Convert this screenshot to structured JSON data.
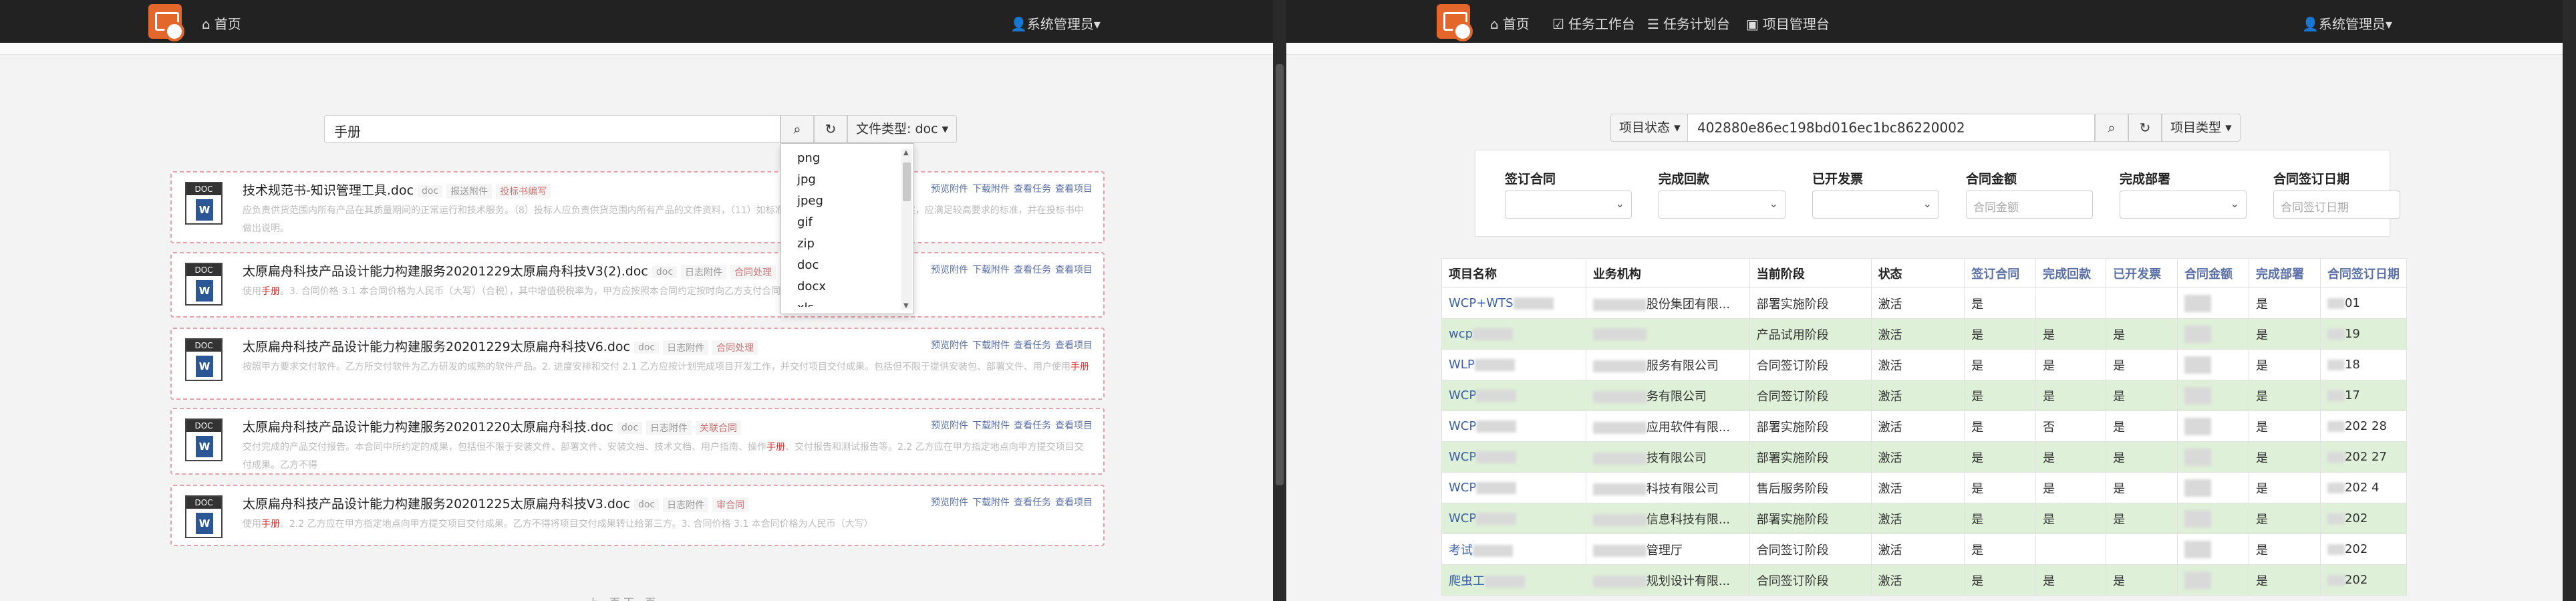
{
  "left": {
    "nav": {
      "home_label": "首页",
      "user_label": "系统管理员"
    },
    "search": {
      "value": "手册",
      "filetype_label": "文件类型: doc"
    },
    "filetype_options": [
      "png",
      "jpg",
      "jpeg",
      "gif",
      "zip",
      "doc",
      "docx",
      "xls"
    ],
    "results": [
      {
        "title": "技术规范书-知识管理工具.doc",
        "type": "doc",
        "tags": [
          "报送附件",
          "投标书编写"
        ],
        "snippet_before": "应负责供货范围内所有产品在其质量期间的正常运行和技术服务。（8）投标人应负责供货范围内所有产品的文件资料，",
        "hl": "",
        "snippet_after": "（11）如标准、规范与本规范书的要求有冲突，应满足较高要求的标准，并在投标书中做出说明。"
      },
      {
        "title": "太原扁舟科技产品设计能力构建服务20201229太原扁舟科技V3(2).doc",
        "type": "doc",
        "tags": [
          "日志附件",
          "合同处理"
        ],
        "snippet_before": "使用",
        "hl": "手册",
        "snippet_after": "。3. 合同价格 3.1 本合同价格为人民币（大写）（合税），其中增值税税率为，甲方应按照本合同约定按时向乙方支付合同价款。"
      },
      {
        "title": "太原扁舟科技产品设计能力构建服务20201229太原扁舟科技V6.doc",
        "type": "doc",
        "tags": [
          "日志附件",
          "合同处理"
        ],
        "snippet_before": "按照甲方要求交付软件。乙方所交付软件为乙方研发的成熟的软件产品。2. 进度安排和交付 2.1 乙方应按计划完成项目开发工作，并交付项目交付成果。包括但不限于提供安装包、部署文件、用户使用",
        "hl": "手册",
        "snippet_after": ""
      },
      {
        "title": "太原扁舟科技产品设计能力构建服务20201220太原扁舟科技.doc",
        "type": "doc",
        "tags": [
          "日志附件",
          "关联合同"
        ],
        "snippet_before": "交付完成的产品交付报告。本合同中所约定的成果，包括但不限于安装文件、部署文件、安装文档、技术文档、用户指南、操作",
        "hl": "手册",
        "snippet_after": "、交付报告和测试报告等。2.2 乙方应在甲方指定地点向甲方提交项目交付成果。乙方不得"
      },
      {
        "title": "太原扁舟科技产品设计能力构建服务20201225太原扁舟科技V3.doc",
        "type": "doc",
        "tags": [
          "日志附件",
          "审合同"
        ],
        "snippet_before": "使用",
        "hl": "手册",
        "snippet_after": "。2.2 乙方应在甲方指定地点向甲方提交项目交付成果。乙方不得将项目交付成果转让给第三方。3. 合同价格 3.1 本合同价格为人民币（大写）"
      }
    ],
    "actions": [
      "预览附件",
      "下载附件",
      "查看任务",
      "查看项目"
    ],
    "pager_text": "上一页 下一页"
  },
  "right": {
    "nav": {
      "home_label": "首页",
      "workbench_label": "任务工作台",
      "plan_label": "任务计划台",
      "project_label": "项目管理台",
      "user_label": "系统管理员"
    },
    "search": {
      "status_label": "项目状态",
      "value": "402880e86ec198bd016ec1bc86220002",
      "type_label": "项目类型"
    },
    "filters": {
      "f1": "签订合同",
      "f2": "完成回款",
      "f3": "已开发票",
      "f4": "合同金额",
      "f5": "完成部署",
      "f6": "合同签订日期",
      "amount_placeholder": "合同金额",
      "date_placeholder": "合同签订日期"
    },
    "columns": [
      "项目名称",
      "业务机构",
      "当前阶段",
      "状态",
      "签订合同",
      "完成回款",
      "已开发票",
      "合同金额",
      "完成部署",
      "合同签订日期"
    ],
    "rows": [
      {
        "name": "WCP+WTS",
        "org": "股份集团有限...",
        "stage": "部署实施阶段",
        "status": "激活",
        "c1": "是",
        "c2": "",
        "c3": "",
        "c5": "是",
        "date": "01",
        "green": false
      },
      {
        "name": "wcp",
        "org": "",
        "stage": "产品试用阶段",
        "status": "激活",
        "c1": "是",
        "c2": "是",
        "c3": "是",
        "c5": "是",
        "date": "19",
        "green": true
      },
      {
        "name": "WLP",
        "org": "服务有限公司",
        "stage": "合同签订阶段",
        "status": "激活",
        "c1": "是",
        "c2": "是",
        "c3": "是",
        "c5": "是",
        "date": "18",
        "green": false
      },
      {
        "name": "WCP",
        "org": "务有限公司",
        "stage": "合同签订阶段",
        "status": "激活",
        "c1": "是",
        "c2": "是",
        "c3": "是",
        "c5": "是",
        "date": "17",
        "green": true
      },
      {
        "name": "WCP",
        "org": "应用软件有限...",
        "stage": "部署实施阶段",
        "status": "激活",
        "c1": "是",
        "c2": "否",
        "c3": "是",
        "c5": "是",
        "date": "202 28",
        "green": false
      },
      {
        "name": "WCP",
        "org": "技有限公司",
        "stage": "部署实施阶段",
        "status": "激活",
        "c1": "是",
        "c2": "是",
        "c3": "是",
        "c5": "是",
        "date": "202 27",
        "green": true
      },
      {
        "name": "WCP",
        "org": "科技有限公司",
        "stage": "售后服务阶段",
        "status": "激活",
        "c1": "是",
        "c2": "是",
        "c3": "是",
        "c5": "是",
        "date": "202 4",
        "green": false
      },
      {
        "name": "WCP",
        "org": "信息科技有限...",
        "stage": "部署实施阶段",
        "status": "激活",
        "c1": "是",
        "c2": "是",
        "c3": "是",
        "c5": "是",
        "date": "202",
        "green": true
      },
      {
        "name": "考试",
        "org": "管理厅",
        "stage": "合同签订阶段",
        "status": "激活",
        "c1": "是",
        "c2": "",
        "c3": "",
        "c5": "是",
        "date": "202",
        "green": false
      },
      {
        "name": "爬虫工",
        "org": "规划设计有限...",
        "stage": "合同签订阶段",
        "status": "激活",
        "c1": "是",
        "c2": "是",
        "c3": "是",
        "c5": "是",
        "date": "202",
        "green": true
      }
    ]
  }
}
